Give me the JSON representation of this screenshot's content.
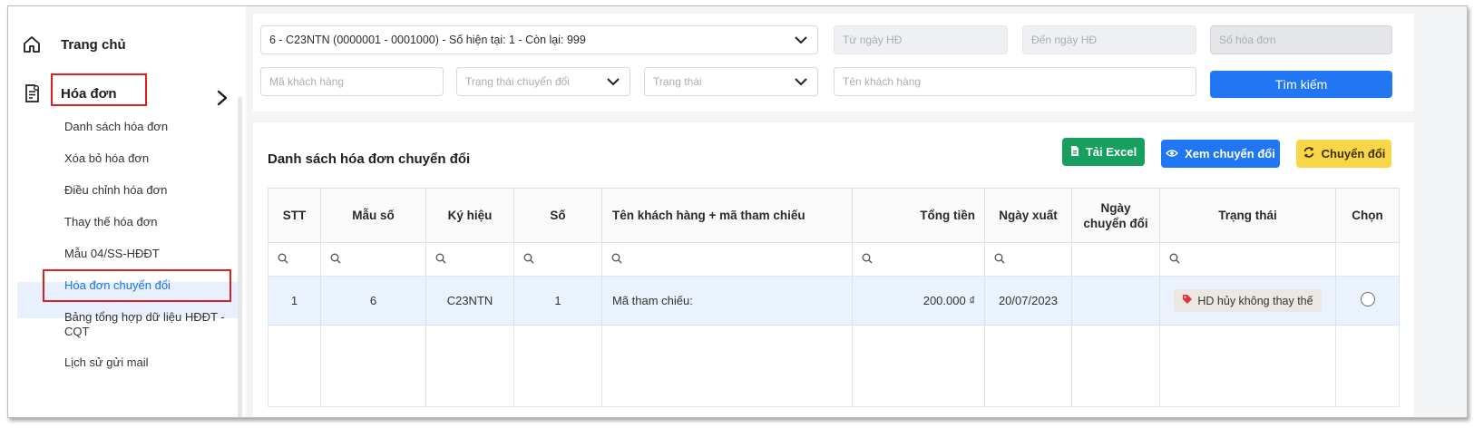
{
  "sidebar": {
    "home_label": "Trang chủ",
    "invoice_label": "Hóa đơn",
    "items": [
      {
        "label": "Danh sách hóa đơn"
      },
      {
        "label": "Xóa bỏ hóa đơn"
      },
      {
        "label": "Điều chỉnh hóa đơn"
      },
      {
        "label": "Thay thế hóa đơn"
      },
      {
        "label": "Mẫu 04/SS-HĐĐT"
      },
      {
        "label": "Hóa đơn chuyển đổi"
      },
      {
        "label": "Bảng tổng hợp dữ liệu HĐĐT - CQT"
      },
      {
        "label": "Lịch sử gửi mail"
      }
    ]
  },
  "filters": {
    "series_select": "6 - C23NTN (0000001 - 0001000) - Số hiện tại: 1 - Còn lại: 999",
    "from_date_placeholder": "Từ ngày HĐ",
    "to_date_placeholder": "Đến ngày HĐ",
    "invoice_no_placeholder": "Số hóa đơn",
    "customer_code_placeholder": "Mã khách hàng",
    "convert_status_placeholder": "Trạng thái chuyển đổi",
    "status_placeholder": "Trạng thái",
    "customer_name_placeholder": "Tên khách hàng",
    "search_button": "Tìm kiếm"
  },
  "list": {
    "title": "Danh sách hóa đơn chuyển đổi",
    "excel_button": "Tải Excel",
    "view_button": "Xem chuyển đổi",
    "convert_button": "Chuyển đổi"
  },
  "table": {
    "headers": [
      "STT",
      "Mẫu số",
      "Ký hiệu",
      "Số",
      "Tên khách hàng + mã tham chiếu",
      "Tổng tiền",
      "Ngày xuất",
      "Ngày chuyển đổi",
      "Trạng thái",
      "Chọn"
    ],
    "rows": [
      {
        "stt": "1",
        "mau_so": "6",
        "ky_hieu": "C23NTN",
        "so": "1",
        "ten_kh": "Mã tham chiếu:",
        "tong_tien": "200.000 ₫",
        "ngay_xuat": "20/07/2023",
        "ngay_chuyen_doi": "",
        "trang_thai": "HD hủy không thay thế"
      }
    ]
  },
  "colors": {
    "primary": "#2176f3",
    "excel": "#17a05d",
    "convert": "#f7d648",
    "highlight_box": "#e02020"
  }
}
